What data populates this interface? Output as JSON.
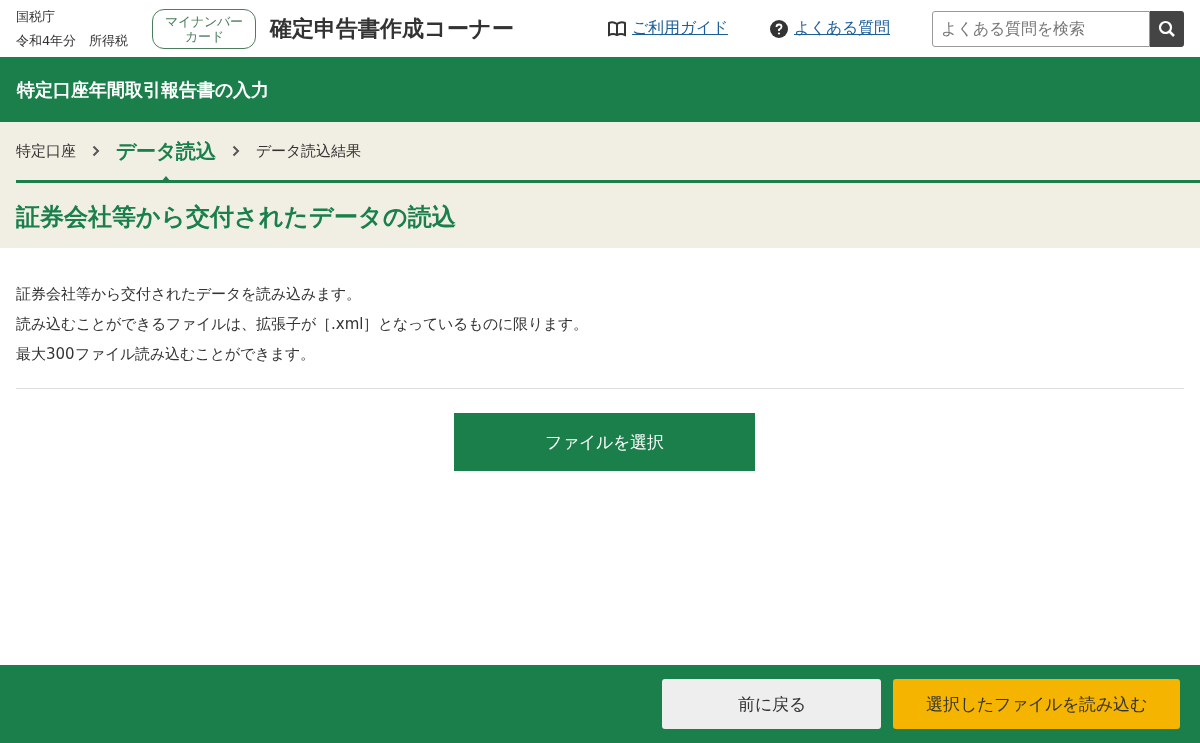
{
  "header": {
    "agency": "国税庁",
    "year_tax": "令和4年分　所得税",
    "mynumber_button": "マイナンバーカード",
    "title": "確定申告書作成コーナー",
    "guide_link": "ご利用ガイド",
    "faq_link": "よくある質問",
    "search": {
      "placeholder": "よくある質問を検索"
    }
  },
  "section_bar": {
    "title": "特定口座年間取引報告書の入力"
  },
  "steps": [
    {
      "label": "特定口座",
      "selected": false
    },
    {
      "label": "データ読込",
      "selected": true
    },
    {
      "label": "データ読込結果",
      "selected": false
    }
  ],
  "page_title": "証券会社等から交付されたデータの読込",
  "description": [
    "証券会社等から交付されたデータを読み込みます。",
    "読み込むことができるファイルは、拡張子が［.xml］となっているものに限ります。",
    "最大300ファイル読み込むことができます。"
  ],
  "file_button": "ファイルを選択",
  "footer": {
    "back_button": "前に戻る",
    "load_button": "選択したファイルを読み込む"
  }
}
